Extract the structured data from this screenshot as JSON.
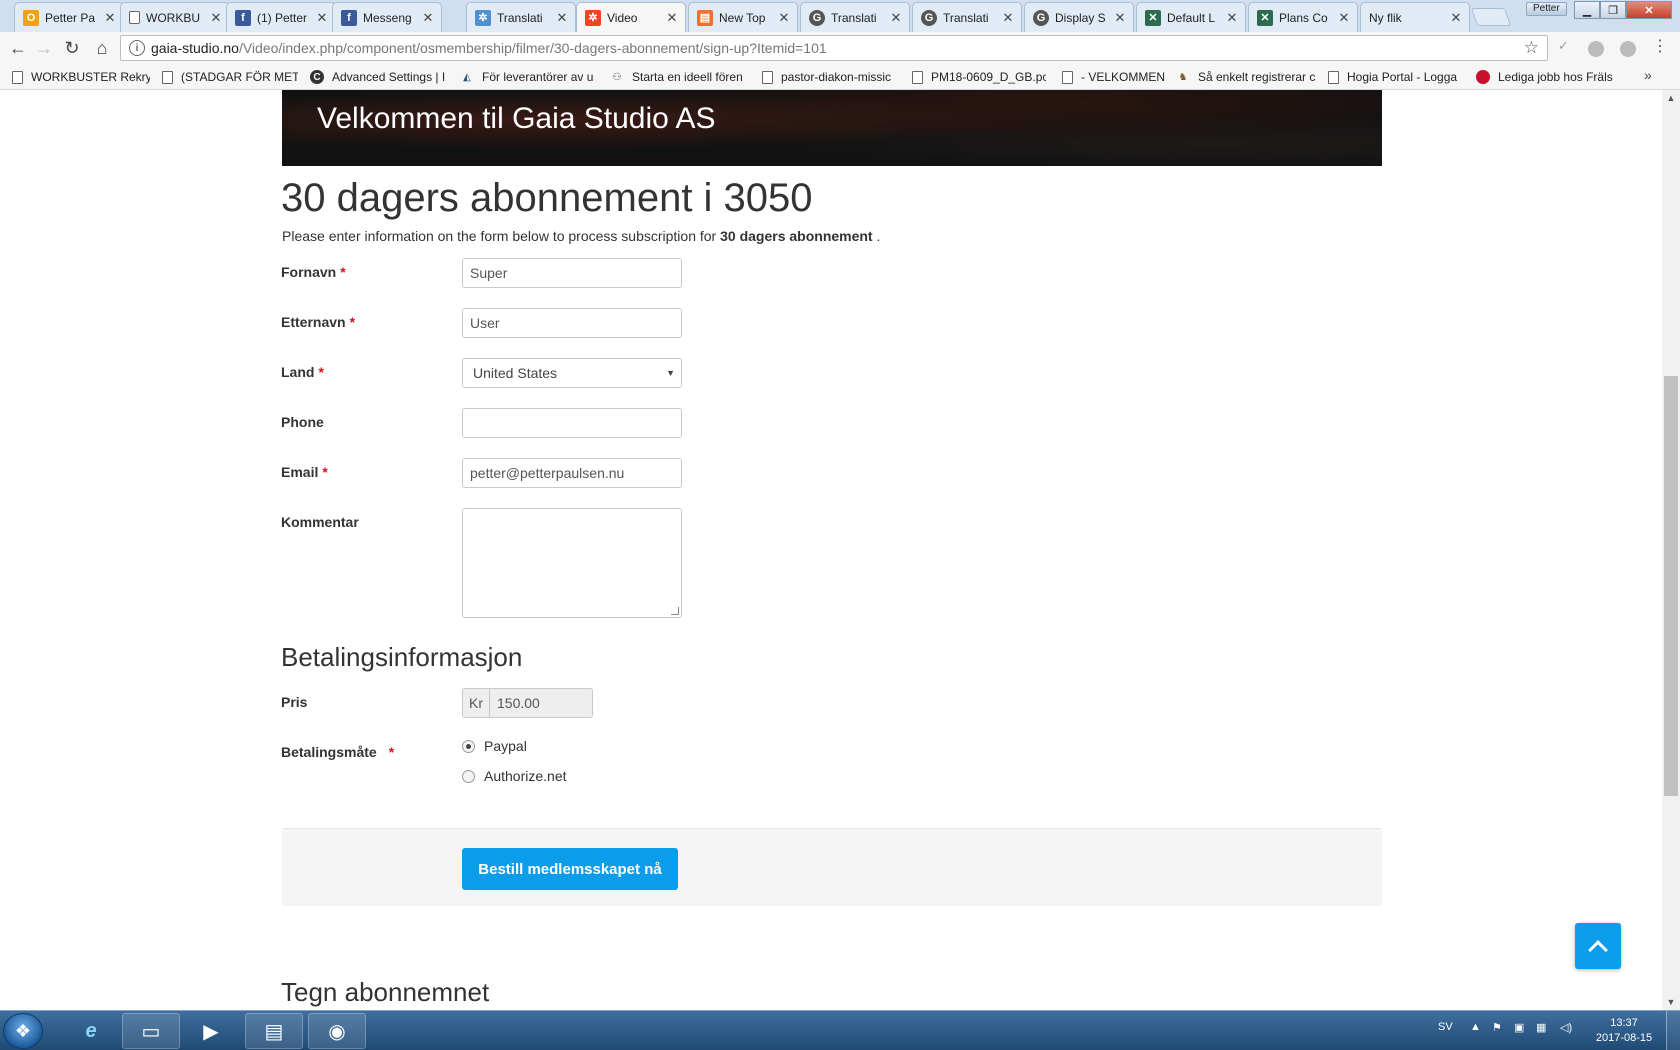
{
  "browser": {
    "tabs": [
      {
        "title": "Petter Pa",
        "icon": "outlook-icon",
        "color": "#f0a30a",
        "glyph": "O"
      },
      {
        "title": "WORKBU",
        "icon": "document-icon",
        "color": "#ffffff",
        "glyph": ""
      },
      {
        "title": "(1) Petter",
        "icon": "facebook-icon",
        "color": "#3b5998",
        "glyph": "f"
      },
      {
        "title": "Messeng",
        "icon": "facebook-icon",
        "color": "#3b5998",
        "glyph": "f"
      },
      {
        "title": "Translati",
        "icon": "joomla-icon",
        "color": "#5091cd",
        "glyph": "✲"
      },
      {
        "title": "Video",
        "icon": "joomla-icon",
        "color": "#f44321",
        "glyph": "✲"
      },
      {
        "title": "New Top",
        "icon": "forum-icon",
        "color": "#f0712d",
        "glyph": "▤"
      },
      {
        "title": "Translati",
        "icon": "globe-icon",
        "color": "#555555",
        "glyph": "G"
      },
      {
        "title": "Translati",
        "icon": "globe-icon",
        "color": "#555555",
        "glyph": "G"
      },
      {
        "title": "Display S",
        "icon": "globe-icon",
        "color": "#555555",
        "glyph": "G"
      },
      {
        "title": "Default L",
        "icon": "cms-icon",
        "color": "#2d6a4f",
        "glyph": "✕"
      },
      {
        "title": "Plans Co",
        "icon": "cms-icon",
        "color": "#2d6a4f",
        "glyph": "✕"
      },
      {
        "title": "Ny flik",
        "icon": "",
        "color": "",
        "glyph": ""
      }
    ],
    "active_tab": 5,
    "profile_name": "Petter",
    "url_host": "gaia-studio.no",
    "url_path": "/Video/index.php/component/osmembership/filmer/30-dagers-abonnement/sign-up?Itemid=101",
    "bookmarks": [
      {
        "label": "WORKBUSTER Rekryt",
        "icon": "document-icon"
      },
      {
        "label": "(STADGAR FÖR METO",
        "icon": "document-icon"
      },
      {
        "label": "Advanced Settings | I",
        "icon": "circle-logo-icon"
      },
      {
        "label": "För leverantörer av u",
        "icon": "mountain-icon"
      },
      {
        "label": "Starta en ideell fören",
        "icon": "people-icon"
      },
      {
        "label": "pastor-diakon-missic",
        "icon": "document-icon"
      },
      {
        "label": "PM18-0609_D_GB.pc",
        "icon": "document-icon"
      },
      {
        "label": "- VELKOMMEN",
        "icon": "document-icon"
      },
      {
        "label": "Så enkelt registrerar c",
        "icon": "figure-icon"
      },
      {
        "label": "Hogia Portal - Logga",
        "icon": "document-icon"
      },
      {
        "label": "Lediga jobb hos Fräls",
        "icon": "shield-icon"
      }
    ]
  },
  "page": {
    "hero_title": "Velkommen til Gaia Studio AS",
    "title": "30 dagers abonnement i 3050",
    "intro_prefix": "Please enter information on the form below to process subscription for ",
    "intro_plan": "30 dagers abonnement",
    "intro_suffix": " .",
    "required_mark": "*",
    "fields": {
      "first_name_label": "Fornavn",
      "first_name_value": "Super",
      "last_name_label": "Etternavn",
      "last_name_value": "User",
      "country_label": "Land",
      "country_value": "United States",
      "phone_label": "Phone",
      "phone_value": "",
      "email_label": "Email",
      "email_value": "petter@petterpaulsen.nu",
      "comment_label": "Kommentar"
    },
    "payment": {
      "section_title": "Betalingsinformasjon",
      "price_label": "Pris",
      "currency": "Kr",
      "price_value": "150.00",
      "method_label": "Betalingsmåte",
      "methods": [
        "Paypal",
        "Authorize.net"
      ],
      "selected_method": "Paypal"
    },
    "submit_label": "Bestill medlemsskapet nå",
    "subtitle": "Tegn abonnemnet",
    "accent_color": "#0b9dea"
  },
  "taskbar": {
    "language": "SV",
    "time": "13:37",
    "date": "2017-08-15"
  }
}
